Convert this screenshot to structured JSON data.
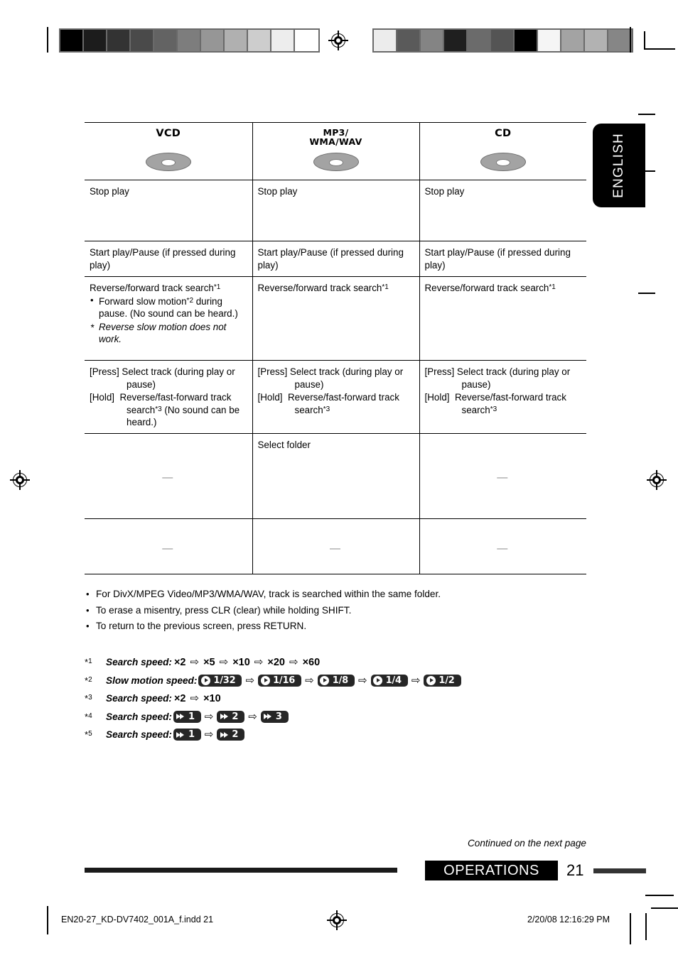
{
  "page": {
    "language_tab": "ENGLISH",
    "section_label": "OPERATIONS",
    "page_number": "21",
    "continued_note": "Continued on the next page"
  },
  "imprint": {
    "file": "EN20-27_KD-DV7402_001A_f.indd   21",
    "date": "2/20/08   12:16:29 PM"
  },
  "table": {
    "columns": [
      {
        "id": "vcd",
        "icon": "disc-icon",
        "label": "VCD",
        "label_lines": [
          "VCD"
        ]
      },
      {
        "id": "mp3",
        "icon": "disc-icon",
        "label": "MP3/ WMA/WAV",
        "label_lines": [
          "MP3/",
          "WMA/WAV"
        ]
      },
      {
        "id": "cd",
        "icon": "disc-icon",
        "label": "CD",
        "label_lines": [
          "CD"
        ]
      }
    ],
    "rows": [
      {
        "id": "stop",
        "cells": [
          {
            "text": "Stop play"
          },
          {
            "text": "Stop play"
          },
          {
            "text": "Stop play"
          }
        ]
      },
      {
        "id": "start-pause",
        "cells": [
          {
            "text": "Start play/Pause (if pressed during play)"
          },
          {
            "text": "Start play/Pause (if pressed during play)"
          },
          {
            "text": "Start play/Pause (if pressed during play)"
          }
        ]
      },
      {
        "id": "track-search",
        "cells": [
          {
            "text": "Reverse/forward track search",
            "footnote": "1",
            "bullets": [
              {
                "text_before": "Forward slow motion",
                "footnote": "2",
                "text_after": " during pause. (No sound can be heard.)"
              }
            ],
            "star_note": "Reverse slow motion does not work."
          },
          {
            "text": "Reverse/forward track search",
            "footnote": "1"
          },
          {
            "text": "Reverse/forward track search",
            "footnote": "1"
          }
        ]
      },
      {
        "id": "select-track",
        "cells": [
          {
            "press_key": "[Press]",
            "press_text": "Select track (during play or pause)",
            "hold_key": "[Hold]",
            "hold_text_before": "Reverse/fast-forward track search",
            "hold_footnote": "3",
            "hold_text_after": " (No sound can be heard.)"
          },
          {
            "press_key": "[Press]",
            "press_text": "Select track (during play or pause)",
            "hold_key": "[Hold]",
            "hold_text_before": "Reverse/fast-forward track search",
            "hold_footnote": "3",
            "hold_text_after": ""
          },
          {
            "press_key": "[Press]",
            "press_text": "Select track (during play or pause)",
            "hold_key": "[Hold]",
            "hold_text_before": "Reverse/fast-forward track search",
            "hold_footnote": "3",
            "hold_text_after": ""
          }
        ]
      },
      {
        "id": "select-folder",
        "cells": [
          {
            "text": "—",
            "empty": true
          },
          {
            "text": "Select folder"
          },
          {
            "text": "—",
            "empty": true
          }
        ]
      },
      {
        "id": "blank",
        "cells": [
          {
            "text": "—",
            "empty": true
          },
          {
            "text": "—",
            "empty": true
          },
          {
            "text": "—",
            "empty": true
          }
        ]
      }
    ]
  },
  "notes": [
    "For DivX/MPEG Video/MP3/WMA/WAV, track is searched within the same folder.",
    "To erase a misentry, press CLR (clear) while holding SHIFT.",
    "To return to the previous screen, press RETURN."
  ],
  "footnotes": [
    {
      "key": "1",
      "label": "Search speed:",
      "kind": "plain",
      "steps": [
        "×2",
        "×5",
        "×10",
        "×20",
        "×60"
      ]
    },
    {
      "key": "2",
      "label": "Slow motion speed:",
      "kind": "badge-play",
      "steps": [
        "1/32",
        "1/16",
        "1/8",
        "1/4",
        "1/2"
      ]
    },
    {
      "key": "3",
      "label": "Search speed:",
      "kind": "plain",
      "steps": [
        "×2",
        "×10"
      ]
    },
    {
      "key": "4",
      "label": "Search speed:",
      "kind": "badge-ff",
      "steps": [
        "1",
        "2",
        "3"
      ]
    },
    {
      "key": "5",
      "label": "Search speed:",
      "kind": "badge-ff",
      "steps": [
        "1",
        "2"
      ]
    }
  ],
  "gray_ramp_left": [
    "#000000",
    "#1c1c1c",
    "#333333",
    "#4a4a4a",
    "#636363",
    "#7d7d7d",
    "#969696",
    "#b0b0b0",
    "#cdcdcd",
    "#ededed",
    "#ffffff"
  ],
  "gray_ramp_right": [
    "#ececec",
    "#5a5a5a",
    "#848484",
    "#1f1f1f",
    "#6b6b6b",
    "#545454",
    "#000000",
    "#f5f5f5",
    "#a3a3a3",
    "#b2b2b2",
    "#868686"
  ],
  "arrow_glyph": "⇨"
}
